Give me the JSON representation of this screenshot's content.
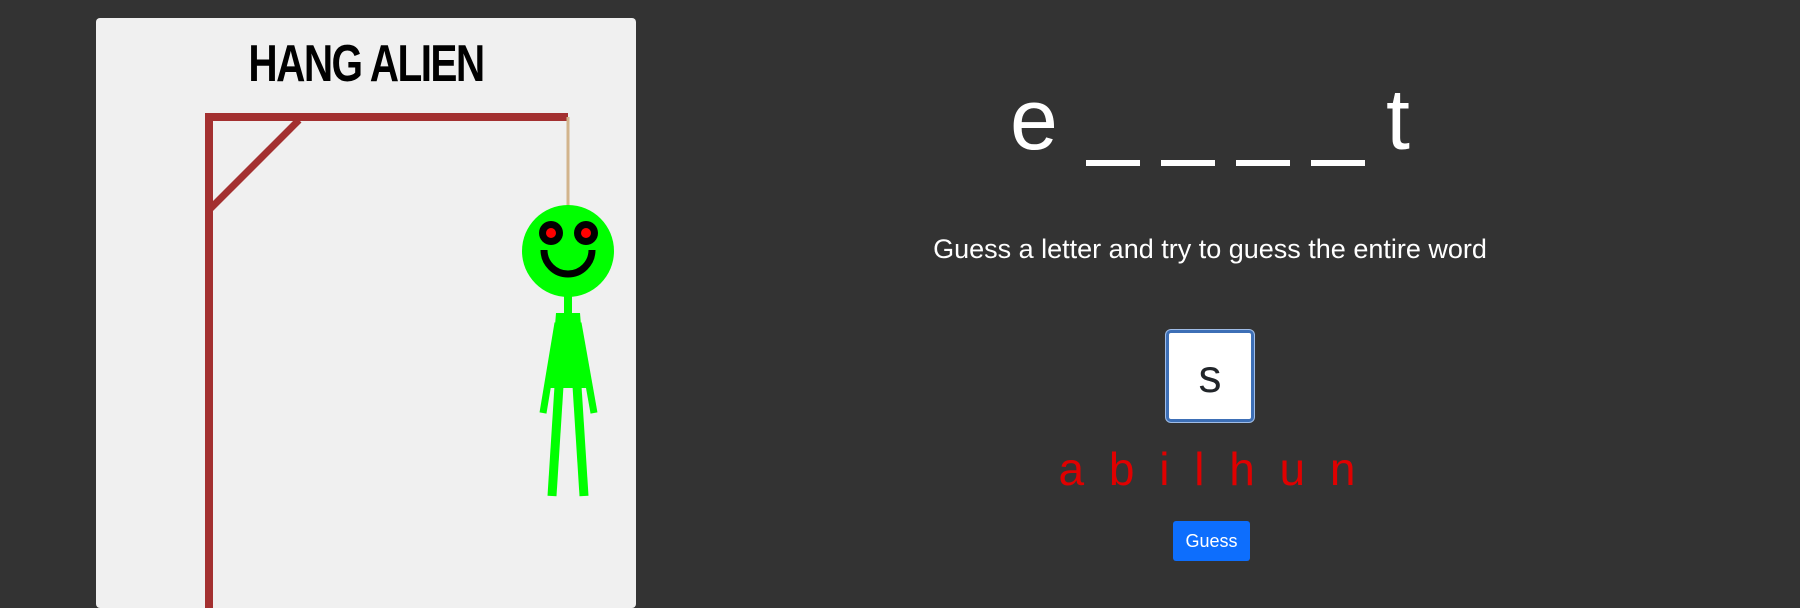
{
  "panel": {
    "title": "HANG ALIEN"
  },
  "word": {
    "letters": [
      "e",
      "",
      "",
      "",
      "",
      "t"
    ]
  },
  "instructions": "Guess a letter and try to guess the entire word",
  "guess_input": {
    "value": "s"
  },
  "wrong_letters": "a b i l h u n",
  "guess_button": {
    "label": "Guess"
  },
  "colors": {
    "background": "#333333",
    "panel": "#f0f0f0",
    "gallows": "#a33030",
    "rope": "#d2b48c",
    "alien": "#00ff00",
    "alien_eyes": "#ff0000",
    "wrong_letters": "#e00000",
    "button": "#0d6efd"
  }
}
